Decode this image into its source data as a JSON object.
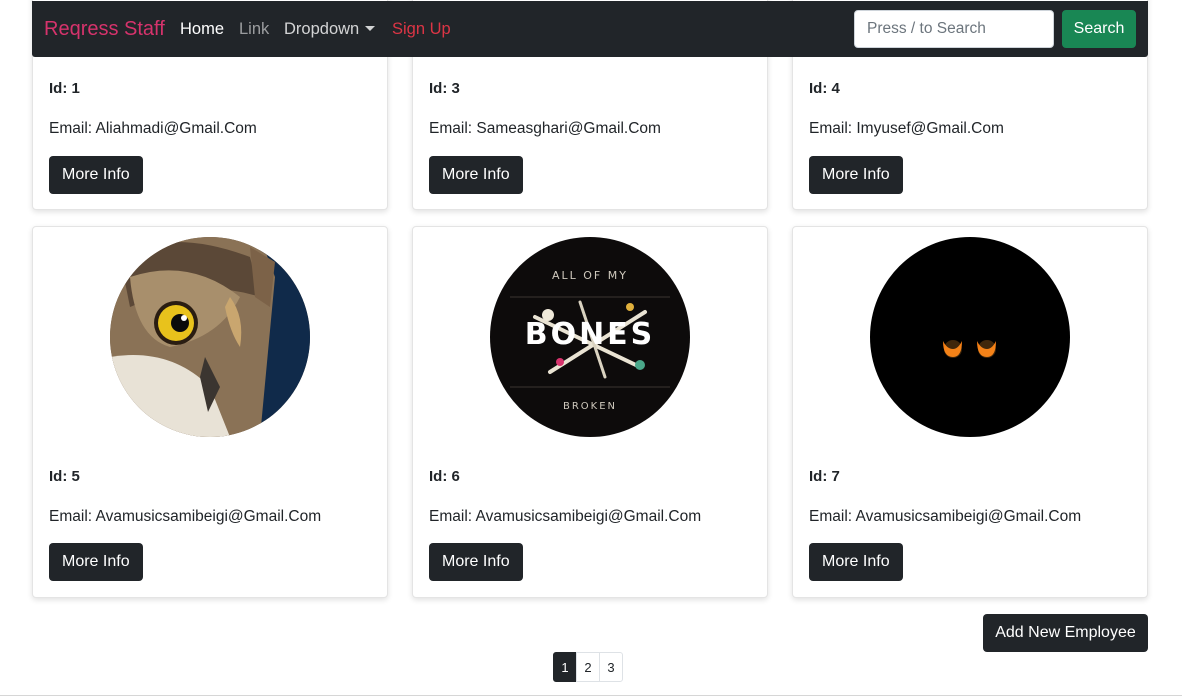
{
  "navbar": {
    "brand": "Reqress Staff",
    "links": [
      {
        "label": "Home",
        "state": "active"
      },
      {
        "label": "Link",
        "state": "muted"
      },
      {
        "label": "Dropdown",
        "state": "dropdown"
      },
      {
        "label": "Sign Up",
        "state": "danger"
      }
    ],
    "search": {
      "placeholder": "Press / to Search",
      "value": "",
      "button_label": "Search"
    }
  },
  "employees_top": [
    {
      "id_text": "Id: 1",
      "email_text": "Email: Aliahmadi@Gmail.Com",
      "button_label": "More Info"
    },
    {
      "id_text": "Id: 3",
      "email_text": "Email: Sameasghari@Gmail.Com",
      "button_label": "More Info"
    },
    {
      "id_text": "Id: 4",
      "email_text": "Email: Imyusef@Gmail.Com",
      "button_label": "More Info"
    }
  ],
  "employees": [
    {
      "id_text": "Id: 5",
      "email_text": "Email: Avamusicsamibeigi@Gmail.Com",
      "button_label": "More Info",
      "avatar": "owl-image"
    },
    {
      "id_text": "Id: 6",
      "email_text": "Email: Avamusicsamibeigi@Gmail.Com",
      "button_label": "More Info",
      "avatar": "bones-album-image",
      "avatar_text": {
        "top": "ALL OF MY",
        "middle": "BONES",
        "bottom": "BROKEN"
      }
    },
    {
      "id_text": "Id: 7",
      "email_text": "Email: Avamusicsamibeigi@Gmail.Com",
      "button_label": "More Info",
      "avatar": "glowing-eyes-image"
    }
  ],
  "actions": {
    "add_label": "Add New Employee"
  },
  "pagination": {
    "pages": [
      "1",
      "2",
      "3"
    ],
    "active": "1"
  },
  "colors": {
    "navbar_bg": "#212529",
    "brand": "#d6336c",
    "signup": "#dc3545",
    "search_button": "#198754",
    "button_dark": "#212529"
  }
}
